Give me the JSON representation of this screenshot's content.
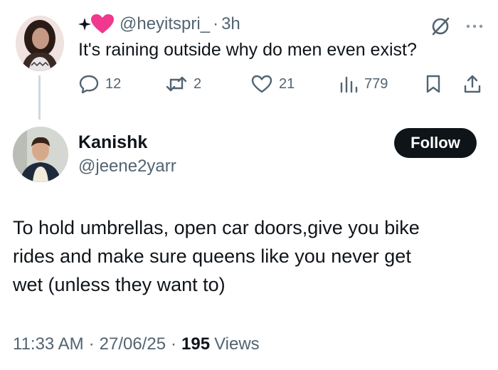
{
  "parent_tweet": {
    "handle": "@heyitspri_",
    "separator": "·",
    "time": "3h",
    "text": "It's raining outside why do men even exist?",
    "actions": {
      "replies": "12",
      "reposts": "2",
      "likes": "21",
      "views": "779"
    },
    "icons": [
      "sparkle-icon",
      "pink-heart-icon",
      "grok-icon",
      "more-icon",
      "reply-icon",
      "repost-icon",
      "like-icon",
      "views-icon",
      "bookmark-icon",
      "share-icon"
    ]
  },
  "reply": {
    "name": "Kanishk",
    "handle": "@jeene2yarr",
    "follow_label": "Follow",
    "text_lines": [
      "To hold umbrellas, open car doors,give you bike",
      "rides and make sure queens like you never get",
      "wet (unless they want to)"
    ],
    "time": "11:33 AM",
    "separator": "·",
    "date": "27/06/25",
    "views_count": "195",
    "views_label": "Views"
  },
  "colors": {
    "text_primary": "#0f1419",
    "text_secondary": "#536471",
    "thread_line": "#cfd9de",
    "follow_bg": "#0f1419",
    "heart_pink": "#f0388e"
  }
}
